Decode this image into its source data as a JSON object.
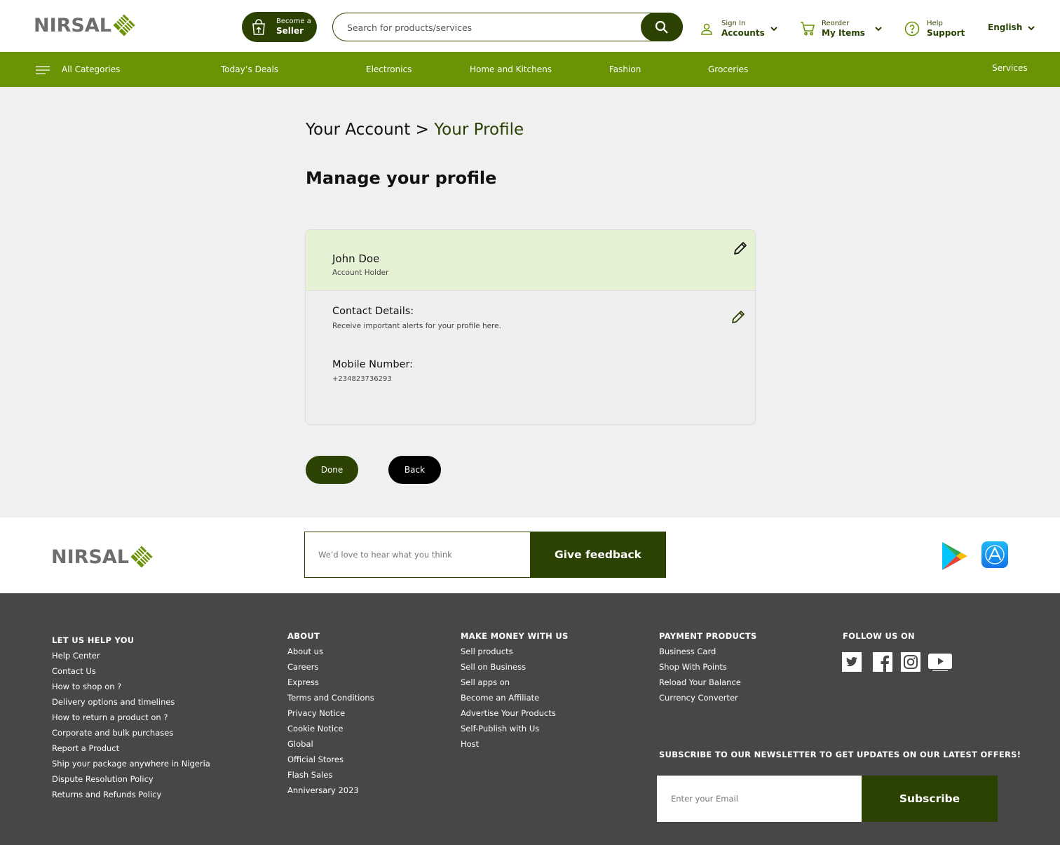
{
  "brand": {
    "name": "NIRSAL",
    "primary_color": "#2b4203",
    "accent_color": "#6a9306",
    "logo_icon": "striped-diamond-logo"
  },
  "header": {
    "seller": {
      "line1": "Become a",
      "line2": "Seller",
      "icon": "shopping-bag-upload-icon"
    },
    "search": {
      "placeholder": "Search for products/services",
      "icon": "search-icon"
    },
    "account": {
      "line1": "Sign In",
      "line2": "Accounts",
      "icon": "user-icon"
    },
    "reorder": {
      "line1": "Reorder",
      "line2": "My Items",
      "icon": "cart-icon"
    },
    "help": {
      "line1": "Help",
      "line2": "Support",
      "icon": "question-circle-icon"
    },
    "language": "English"
  },
  "categories": {
    "all": "All Categories",
    "items": [
      "Today’s Deals",
      "Electronics",
      "Home and Kitchens",
      "Fashion",
      "Groceries"
    ],
    "services": "Services"
  },
  "breadcrumb": {
    "parent": "Your Account",
    "separator": ">",
    "current": "Your Profile"
  },
  "page_title": "Manage your profile",
  "profile": {
    "name": "John Doe",
    "role": "Account Holder",
    "contact_label": "Contact Details:",
    "contact_sub": "Receive important alerts for your profile here.",
    "mobile_label": "Mobile Number:",
    "mobile_value": "+234823736293"
  },
  "actions": {
    "done": "Done",
    "back": "Back"
  },
  "feedback": {
    "placeholder": "We’d love to hear what you think",
    "button": "Give feedback"
  },
  "footer": {
    "help": {
      "title": "LET US HELP YOU",
      "links": [
        "Help Center",
        "Contact Us",
        "How to shop on ?",
        "Delivery options and timelines",
        "How to return a product on ?",
        "Corporate and bulk purchases",
        "Report a Product",
        "Ship your package anywhere in Nigeria",
        "Dispute Resolution Policy",
        "Returns and Refunds Policy"
      ]
    },
    "about": {
      "title": "ABOUT",
      "links": [
        "About us",
        "Careers",
        "Express",
        "Terms and Conditions",
        "Privacy Notice",
        "Cookie Notice",
        "Global",
        "Official Stores",
        "Flash Sales",
        "Anniversary 2023"
      ]
    },
    "money": {
      "title": "MAKE MONEY WITH US",
      "links": [
        "Sell products",
        "Sell on Business",
        "Sell apps on",
        "Become an Affiliate",
        "Advertise Your Products",
        "Self-Publish with Us",
        "Host"
      ]
    },
    "payment": {
      "title": "PAYMENT PRODUCTS",
      "links": [
        "Business Card",
        "Shop With Points",
        "Reload Your Balance",
        "Currency Converter"
      ]
    },
    "follow": {
      "title": "FOLLOW US ON",
      "icons": [
        "twitter-icon",
        "facebook-icon",
        "instagram-icon",
        "youtube-icon"
      ]
    },
    "newsletter": {
      "title": "SUBSCRIBE TO OUR NEWSLETTER TO GET UPDATES ON OUR LATEST OFFERS!",
      "placeholder": "Enter your Email",
      "button": "Subscribe"
    }
  }
}
